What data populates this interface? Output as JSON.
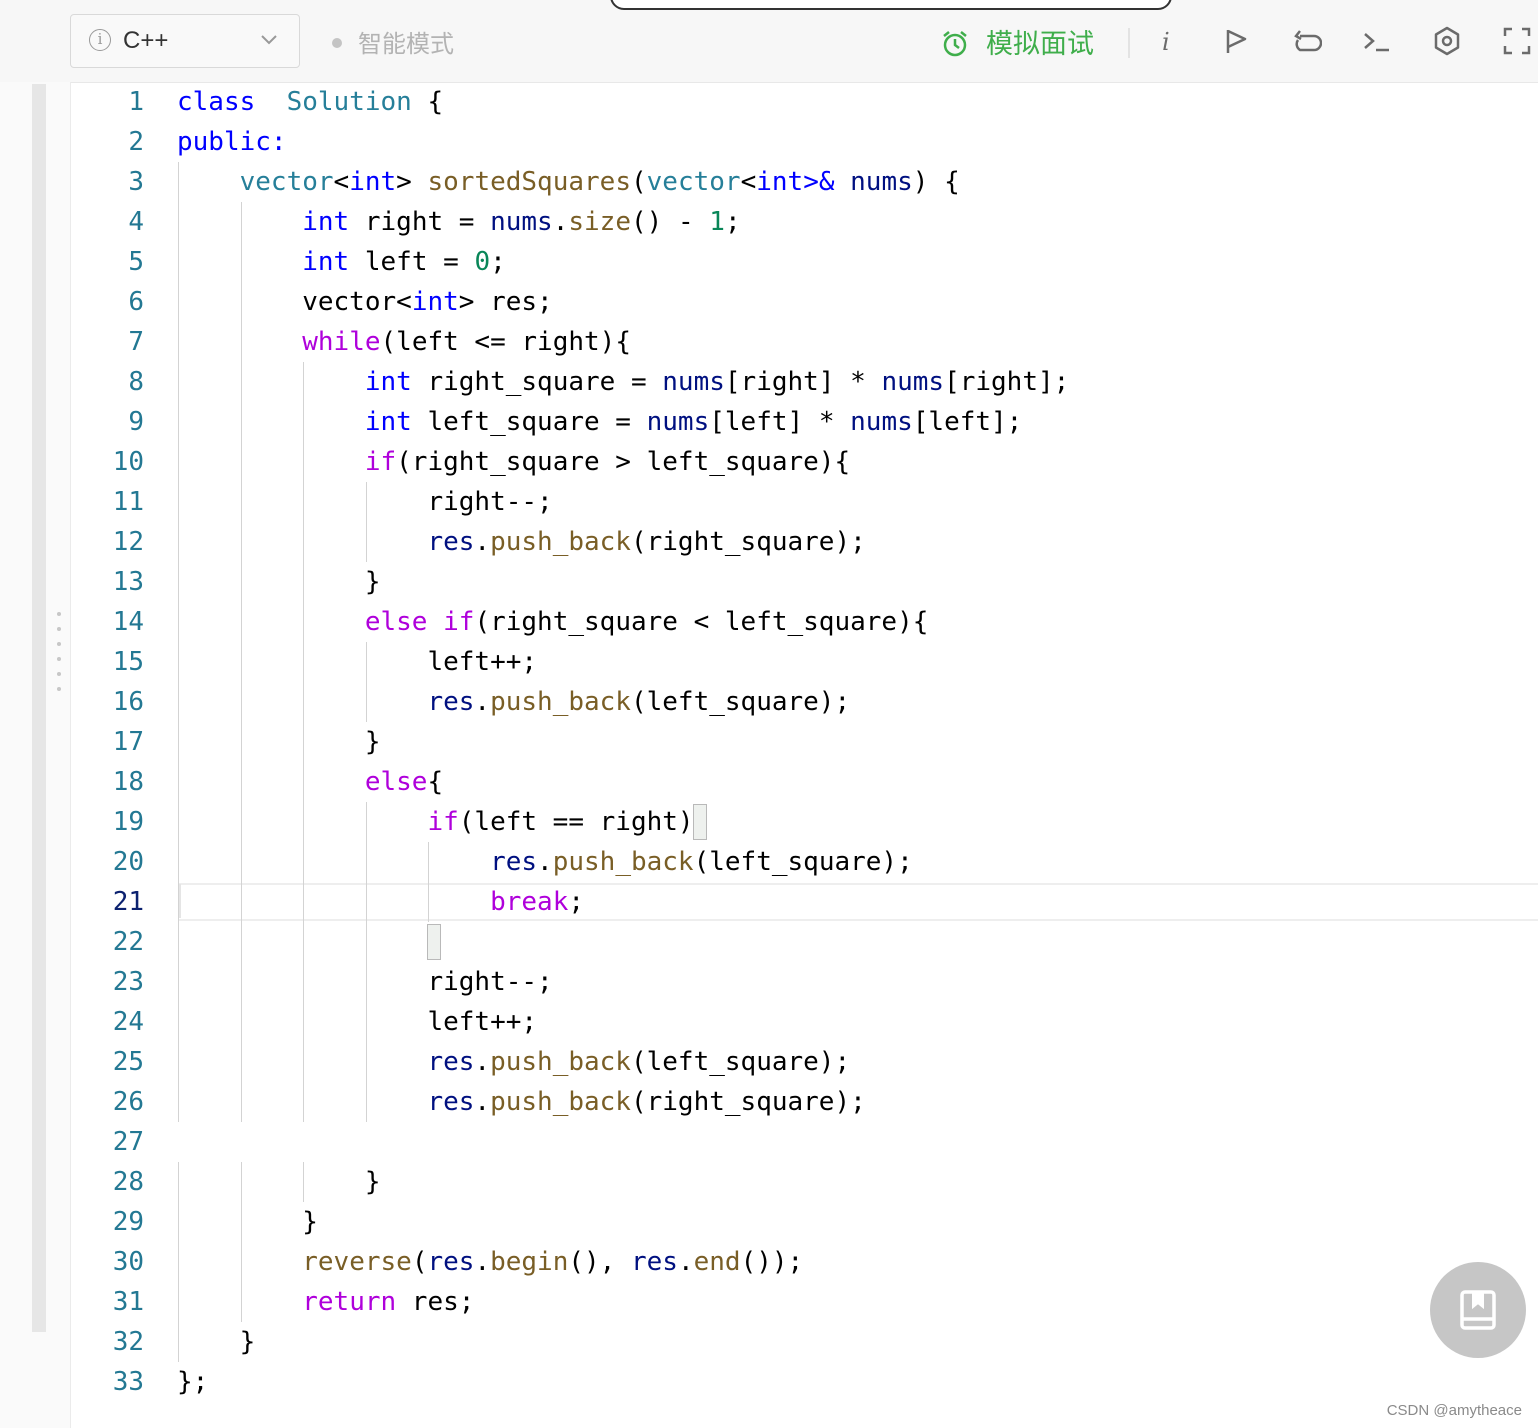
{
  "toolbar": {
    "language": "C++",
    "smart_mode_label": "智能模式",
    "mock_interview_label": "模拟面试",
    "icons": [
      "info-icon",
      "chevron-down-icon",
      "alarm-clock-icon",
      "italic-info-icon",
      "flag-icon",
      "reset-icon",
      "terminal-icon",
      "settings-icon",
      "fullscreen-icon"
    ]
  },
  "editor": {
    "active_line": 21,
    "lines": [
      {
        "n": "1"
      },
      {
        "n": "2"
      },
      {
        "n": "3"
      },
      {
        "n": "4"
      },
      {
        "n": "5"
      },
      {
        "n": "6"
      },
      {
        "n": "7"
      },
      {
        "n": "8"
      },
      {
        "n": "9"
      },
      {
        "n": "10"
      },
      {
        "n": "11"
      },
      {
        "n": "12"
      },
      {
        "n": "13"
      },
      {
        "n": "14"
      },
      {
        "n": "15"
      },
      {
        "n": "16"
      },
      {
        "n": "17"
      },
      {
        "n": "18"
      },
      {
        "n": "19"
      },
      {
        "n": "20"
      },
      {
        "n": "21"
      },
      {
        "n": "22"
      },
      {
        "n": "23"
      },
      {
        "n": "24"
      },
      {
        "n": "25"
      },
      {
        "n": "26"
      },
      {
        "n": "27"
      },
      {
        "n": "28"
      },
      {
        "n": "29"
      },
      {
        "n": "30"
      },
      {
        "n": "31"
      },
      {
        "n": "32"
      },
      {
        "n": "33"
      }
    ],
    "code": [
      [
        [
          "k",
          "class"
        ],
        [
          "",
          "  "
        ],
        [
          "ty",
          "Solution"
        ],
        [
          "",
          " {"
        ]
      ],
      [
        [
          "k",
          "public:"
        ]
      ],
      [
        [
          "",
          "    "
        ],
        [
          "ty",
          "vector"
        ],
        [
          "",
          "<"
        ],
        [
          "kt",
          "int"
        ],
        [
          "",
          "> "
        ],
        [
          "fn",
          "sortedSquares"
        ],
        [
          "",
          "("
        ],
        [
          "ty",
          "vector"
        ],
        [
          "",
          "<"
        ],
        [
          "kt",
          "int"
        ],
        [
          "k",
          ">&"
        ],
        [
          "",
          " "
        ],
        [
          "vr",
          "nums"
        ],
        [
          "",
          ") {"
        ]
      ],
      [
        [
          "",
          "        "
        ],
        [
          "kt",
          "int"
        ],
        [
          "",
          " right = "
        ],
        [
          "vr",
          "nums"
        ],
        [
          "",
          "."
        ],
        [
          "fn",
          "size"
        ],
        [
          "",
          "() - "
        ],
        [
          "nm",
          "1"
        ],
        [
          "",
          ";"
        ]
      ],
      [
        [
          "",
          "        "
        ],
        [
          "kt",
          "int"
        ],
        [
          "",
          " left = "
        ],
        [
          "nm",
          "0"
        ],
        [
          "",
          ";"
        ]
      ],
      [
        [
          "",
          "        vector<"
        ],
        [
          "kt",
          "int"
        ],
        [
          "",
          "> res;"
        ]
      ],
      [
        [
          "",
          "        "
        ],
        [
          "cf",
          "while"
        ],
        [
          "",
          "(left <= right){"
        ]
      ],
      [
        [
          "",
          "            "
        ],
        [
          "kt",
          "int"
        ],
        [
          "",
          " right_square = "
        ],
        [
          "vr",
          "nums"
        ],
        [
          "",
          "[right] * "
        ],
        [
          "vr",
          "nums"
        ],
        [
          "",
          "[right];"
        ]
      ],
      [
        [
          "",
          "            "
        ],
        [
          "kt",
          "int"
        ],
        [
          "",
          " left_square = "
        ],
        [
          "vr",
          "nums"
        ],
        [
          "",
          "[left] * "
        ],
        [
          "vr",
          "nums"
        ],
        [
          "",
          "[left];"
        ]
      ],
      [
        [
          "",
          "            "
        ],
        [
          "cf",
          "if"
        ],
        [
          "",
          "(right_square > left_square){"
        ]
      ],
      [
        [
          "",
          "                right--;"
        ]
      ],
      [
        [
          "",
          "                "
        ],
        [
          "vr",
          "res"
        ],
        [
          "",
          "."
        ],
        [
          "fn",
          "push_back"
        ],
        [
          "",
          "(right_square);"
        ]
      ],
      [
        [
          "",
          "            }"
        ]
      ],
      [
        [
          "",
          "            "
        ],
        [
          "cf",
          "else"
        ],
        [
          "",
          " "
        ],
        [
          "cf",
          "if"
        ],
        [
          "",
          "(right_square < left_square){"
        ]
      ],
      [
        [
          "",
          "                left++;"
        ]
      ],
      [
        [
          "",
          "                "
        ],
        [
          "vr",
          "res"
        ],
        [
          "",
          "."
        ],
        [
          "fn",
          "push_back"
        ],
        [
          "",
          "(left_square);"
        ]
      ],
      [
        [
          "",
          "            }"
        ]
      ],
      [
        [
          "",
          "            "
        ],
        [
          "cf",
          "else"
        ],
        [
          "",
          "{"
        ]
      ],
      [
        [
          "",
          "                "
        ],
        [
          "cf",
          "if"
        ],
        [
          "",
          "(left == right){"
        ]
      ],
      [
        [
          "",
          "                    "
        ],
        [
          "vr",
          "res"
        ],
        [
          "",
          "."
        ],
        [
          "fn",
          "push_back"
        ],
        [
          "",
          "(left_square);"
        ]
      ],
      [
        [
          "",
          "                    "
        ],
        [
          "cf",
          "break"
        ],
        [
          "",
          ";"
        ]
      ],
      [
        [
          "",
          "                }"
        ]
      ],
      [
        [
          "",
          "                right--;"
        ]
      ],
      [
        [
          "",
          "                left++;"
        ]
      ],
      [
        [
          "",
          "                "
        ],
        [
          "vr",
          "res"
        ],
        [
          "",
          "."
        ],
        [
          "fn",
          "push_back"
        ],
        [
          "",
          "(left_square);"
        ]
      ],
      [
        [
          "",
          "                "
        ],
        [
          "vr",
          "res"
        ],
        [
          "",
          "."
        ],
        [
          "fn",
          "push_back"
        ],
        [
          "",
          "(right_square);"
        ]
      ],
      [
        [
          "",
          ""
        ]
      ],
      [
        [
          "",
          "            }"
        ]
      ],
      [
        [
          "",
          "        }"
        ]
      ],
      [
        [
          "",
          "        "
        ],
        [
          "fn",
          "reverse"
        ],
        [
          "",
          "("
        ],
        [
          "vr",
          "res"
        ],
        [
          "",
          "."
        ],
        [
          "fn",
          "begin"
        ],
        [
          "",
          "(), "
        ],
        [
          "vr",
          "res"
        ],
        [
          "",
          "."
        ],
        [
          "fn",
          "end"
        ],
        [
          "",
          "());"
        ]
      ],
      [
        [
          "",
          "        "
        ],
        [
          "cf",
          "return"
        ],
        [
          "",
          " res;"
        ]
      ],
      [
        [
          "",
          "    }"
        ]
      ],
      [
        [
          "",
          "};"
        ]
      ]
    ]
  },
  "watermark": "CSDN @amytheace",
  "fab_icon": "notebook-icon"
}
